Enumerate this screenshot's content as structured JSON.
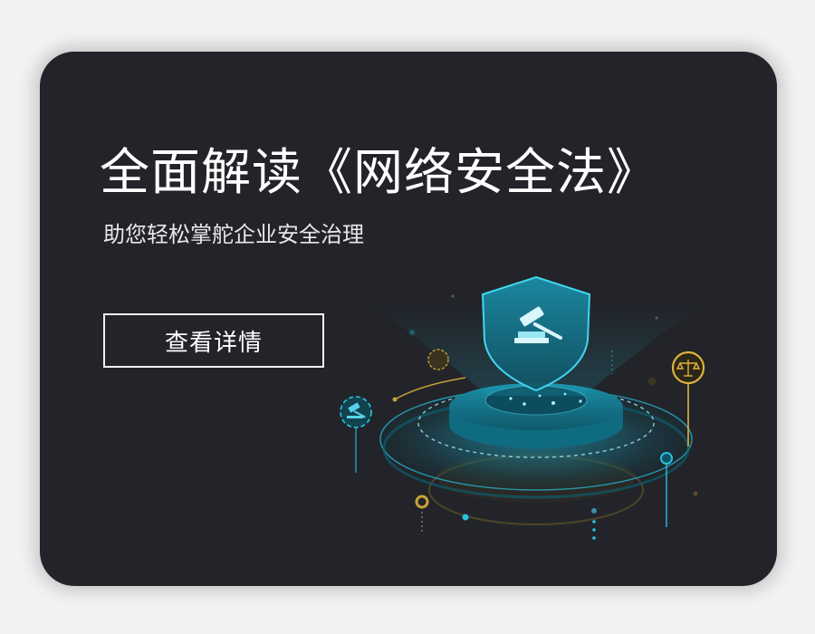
{
  "banner": {
    "title": "全面解读《网络安全法》",
    "subtitle": "助您轻松掌舵企业安全治理",
    "cta_label": "查看详情"
  },
  "illustration": {
    "icons": [
      "shield-icon",
      "gavel-icon",
      "scales-icon"
    ]
  },
  "colors": {
    "background": "#222429",
    "accent_cyan": "#1fb6d2",
    "accent_gold": "#c9a13a",
    "text": "#ffffff"
  }
}
